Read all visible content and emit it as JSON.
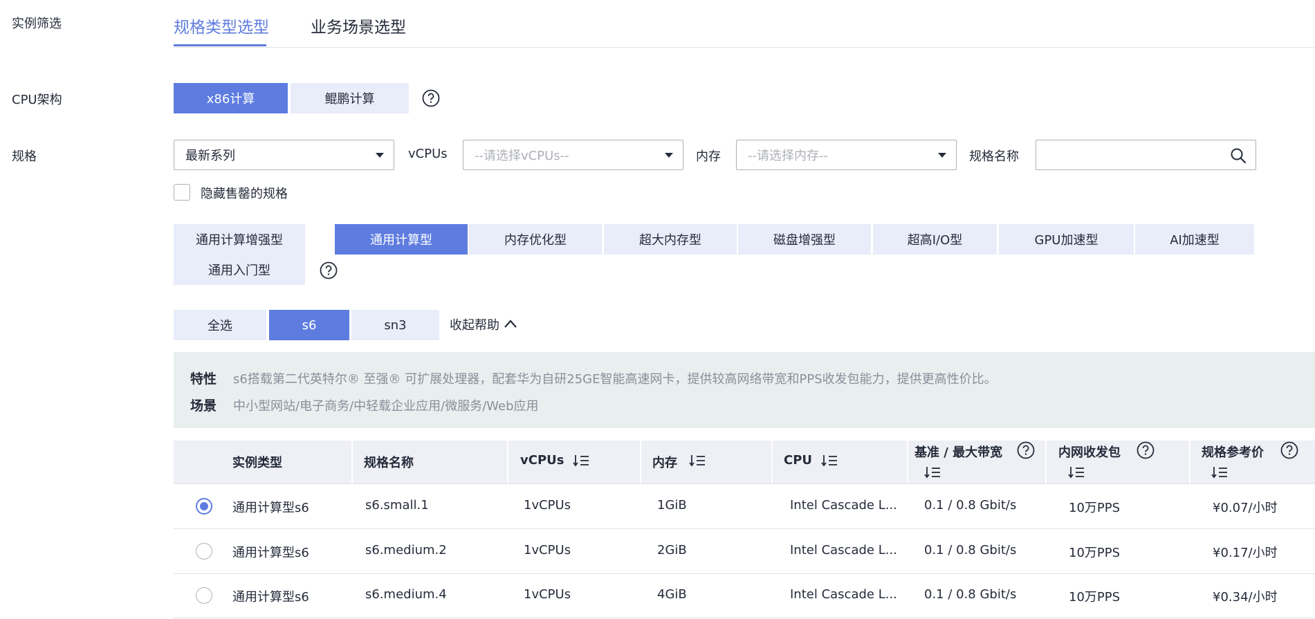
{
  "colors": {
    "accent": "#5e7ce0",
    "segment_bg": "#e9edfa",
    "info_bg": "#e9eeef",
    "table_header_bg": "#eef0f5"
  },
  "labels": {
    "instance_filter": "实例筛选",
    "cpu_arch": "CPU架构",
    "flavor": "规格"
  },
  "mode_tabs": [
    {
      "label": "规格类型选型",
      "active": true
    },
    {
      "label": "业务场景选型",
      "active": false
    }
  ],
  "cpu_arch": {
    "options": [
      {
        "label": "x86计算",
        "active": true
      },
      {
        "label": "鲲鹏计算",
        "active": false
      }
    ]
  },
  "filters": {
    "series_value": "最新系列",
    "vcpus_label": "vCPUs",
    "vcpus_placeholder": "--请选择vCPUs--",
    "memory_label": "内存",
    "memory_placeholder": "--请选择内存--",
    "name_label": "规格名称",
    "name_value": "",
    "hide_soldout_label": "隐藏售罄的规格",
    "hide_soldout_checked": false
  },
  "types": [
    {
      "label": "通用计算增强型",
      "active": false
    },
    {
      "label": "通用计算型",
      "active": true
    },
    {
      "label": "内存优化型",
      "active": false
    },
    {
      "label": "超大内存型",
      "active": false
    },
    {
      "label": "磁盘增强型",
      "active": false
    },
    {
      "label": "超高I/O型",
      "active": false
    },
    {
      "label": "GPU加速型",
      "active": false
    },
    {
      "label": "AI加速型",
      "active": false
    },
    {
      "label": "通用入门型",
      "active": false
    }
  ],
  "series": {
    "options": [
      {
        "label": "全选",
        "active": false
      },
      {
        "label": "s6",
        "active": true
      },
      {
        "label": "sn3",
        "active": false
      }
    ],
    "collapse_help": "收起帮助"
  },
  "info": {
    "feature_key": "特性",
    "feature_text": "s6搭载第二代英特尔® 至强® 可扩展处理器，配套华为自研25GE智能高速网卡，提供较高网络带宽和PPS收发包能力，提供更高性价比。",
    "scene_key": "场景",
    "scene_text": "中小型网站/电子商务/中轻载企业应用/微服务/Web应用"
  },
  "table": {
    "columns": {
      "type": "实例类型",
      "name": "规格名称",
      "vcpus": "vCPUs",
      "memory": "内存",
      "cpu": "CPU",
      "bandwidth": "基准 / 最大带宽",
      "pps": "内网收发包",
      "price": "规格参考价"
    },
    "rows": [
      {
        "selected": true,
        "type": "通用计算型s6",
        "name": "s6.small.1",
        "vcpus": "1vCPUs",
        "memory": "1GiB",
        "cpu": "Intel Cascade L...",
        "bandwidth": "0.1 / 0.8 Gbit/s",
        "pps": "10万PPS",
        "price": "¥0.07/小时"
      },
      {
        "selected": false,
        "type": "通用计算型s6",
        "name": "s6.medium.2",
        "vcpus": "1vCPUs",
        "memory": "2GiB",
        "cpu": "Intel Cascade L...",
        "bandwidth": "0.1 / 0.8 Gbit/s",
        "pps": "10万PPS",
        "price": "¥0.17/小时"
      },
      {
        "selected": false,
        "type": "通用计算型s6",
        "name": "s6.medium.4",
        "vcpus": "1vCPUs",
        "memory": "4GiB",
        "cpu": "Intel Cascade L...",
        "bandwidth": "0.1 / 0.8 Gbit/s",
        "pps": "10万PPS",
        "price": "¥0.34/小时"
      }
    ]
  }
}
